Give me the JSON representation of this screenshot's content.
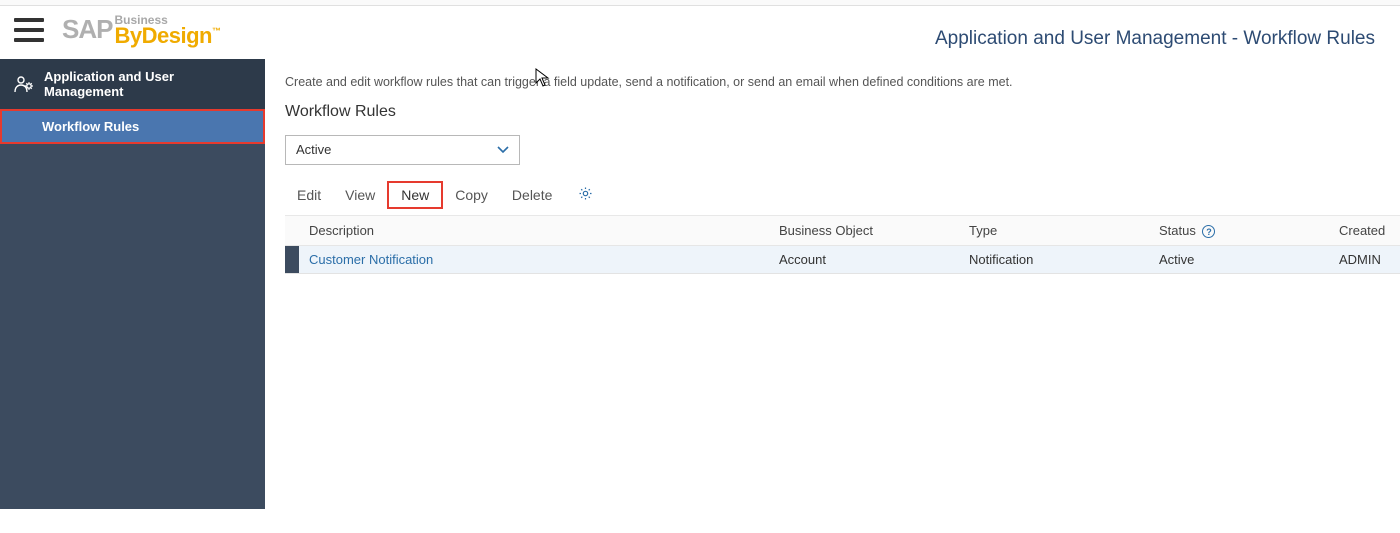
{
  "header": {
    "page_title": "Application and User Management - Workflow Rules",
    "logo": {
      "brand": "SAP",
      "line1": "Business",
      "line2": "ByDesign"
    }
  },
  "sidebar": {
    "parent_label": "Application and User Management",
    "child_label": "Workflow Rules"
  },
  "content": {
    "intro": "Create and edit workflow rules that can trigger a field update, send a notification, or send an email when defined conditions are met.",
    "heading": "Workflow Rules",
    "filter_value": "Active"
  },
  "toolbar": {
    "edit": "Edit",
    "view": "View",
    "new": "New",
    "copy": "Copy",
    "delete": "Delete"
  },
  "table": {
    "columns": {
      "description": "Description",
      "business_object": "Business Object",
      "type": "Type",
      "status": "Status",
      "created_by": "Created"
    },
    "rows": [
      {
        "description": "Customer Notification",
        "business_object": "Account",
        "type": "Notification",
        "status": "Active",
        "created_by": "ADMIN"
      }
    ]
  }
}
